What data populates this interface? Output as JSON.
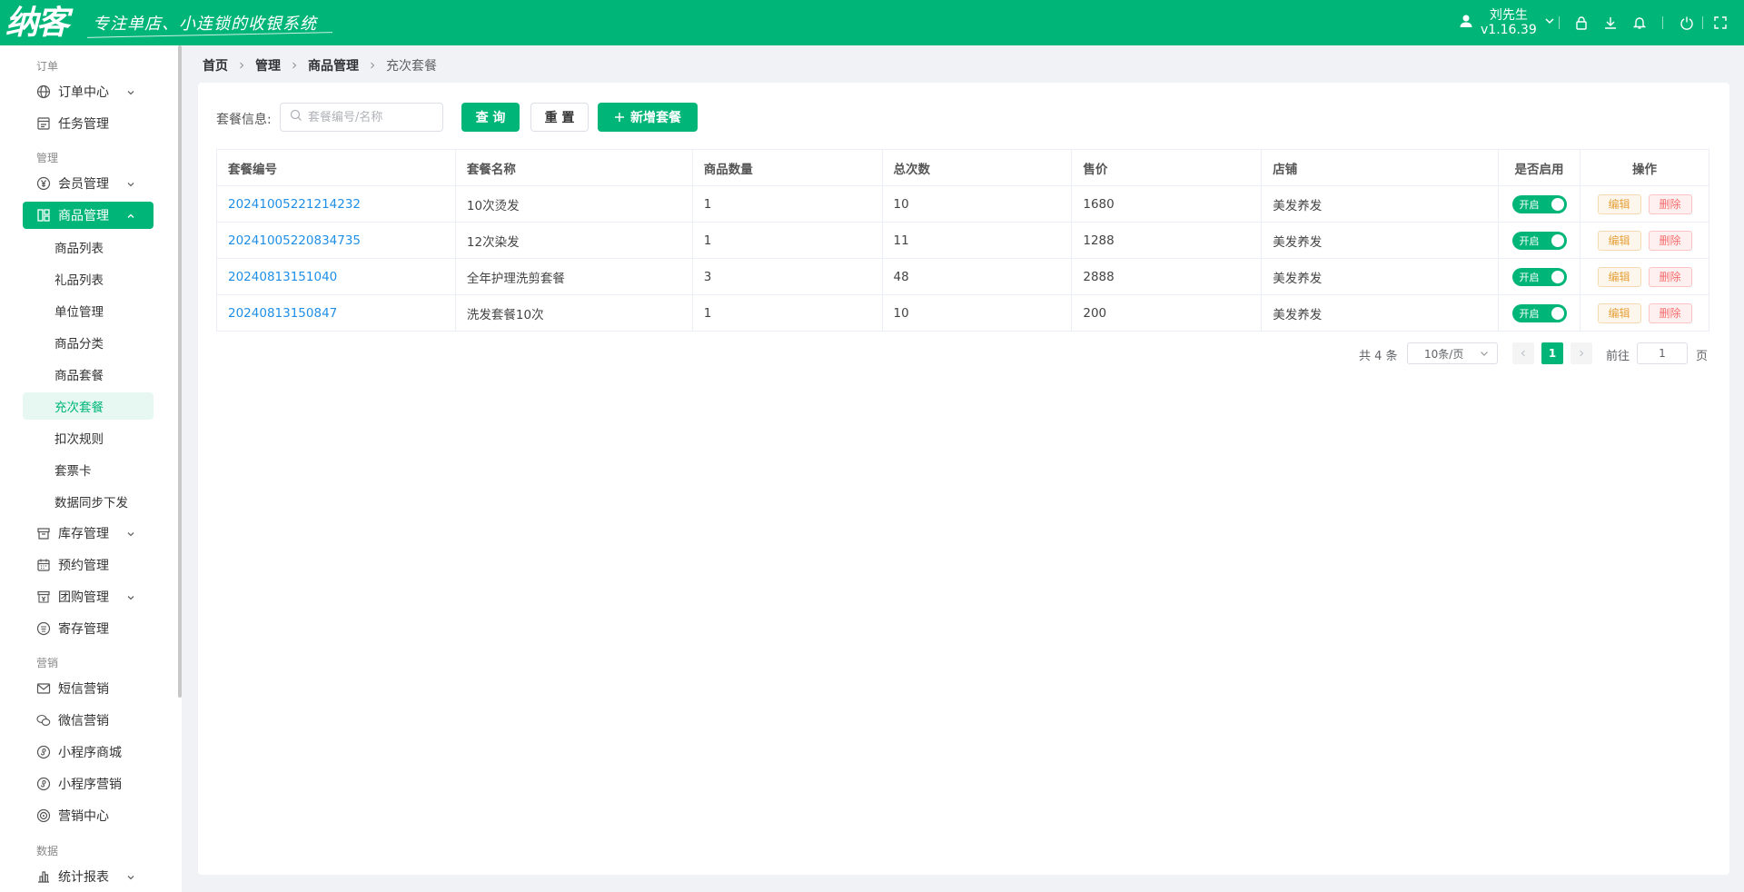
{
  "header": {
    "logo": "纳客",
    "slogan": "专注单店、小连锁的收银系统",
    "user_name": "刘先生",
    "version": "v1.16.39",
    "icons": [
      "user-icon",
      "lock-icon",
      "download-icon",
      "bell-icon",
      "power-icon",
      "fullscreen-icon"
    ]
  },
  "sidebar": {
    "groups": {
      "order": "订单",
      "manage": "管理",
      "marketing": "营销",
      "data": "数据"
    },
    "items": {
      "order_center": "订单中心",
      "task_manage": "任务管理",
      "member_manage": "会员管理",
      "goods_manage": "商品管理",
      "goods_list": "商品列表",
      "gift_list": "礼品列表",
      "unit_manage": "单位管理",
      "goods_category": "商品分类",
      "goods_package": "商品套餐",
      "recharge_package": "充次套餐",
      "deduct_rules": "扣次规则",
      "ticket_card": "套票卡",
      "data_sync": "数据同步下发",
      "stock_manage": "库存管理",
      "booking_manage": "预约管理",
      "group_buy_manage": "团购管理",
      "deposit_manage": "寄存管理",
      "sms_marketing": "短信营销",
      "wechat_marketing": "微信营销",
      "mini_mall": "小程序商城",
      "mini_marketing": "小程序营销",
      "marketing_center": "营销中心",
      "stat_report": "统计报表"
    }
  },
  "breadcrumb": [
    "首页",
    "管理",
    "商品管理",
    "充次套餐"
  ],
  "filter": {
    "label": "套餐信息:",
    "placeholder": "套餐编号/名称",
    "query": "查 询",
    "reset": "重 置",
    "add": "新增套餐"
  },
  "table": {
    "columns": [
      "套餐编号",
      "套餐名称",
      "商品数量",
      "总次数",
      "售价",
      "店铺",
      "是否启用",
      "操作"
    ],
    "rows": [
      {
        "code": "20241005221214232",
        "name": "10次烫发",
        "qty": "1",
        "times": "10",
        "price": "1680",
        "shop": "美发养发",
        "enabled": "开启"
      },
      {
        "code": "20241005220834735",
        "name": "12次染发",
        "qty": "1",
        "times": "11",
        "price": "1288",
        "shop": "美发养发",
        "enabled": "开启"
      },
      {
        "code": "20240813151040",
        "name": "全年护理洗剪套餐",
        "qty": "3",
        "times": "48",
        "price": "2888",
        "shop": "美发养发",
        "enabled": "开启"
      },
      {
        "code": "20240813150847",
        "name": "洗发套餐10次",
        "qty": "1",
        "times": "10",
        "price": "200",
        "shop": "美发养发",
        "enabled": "开启"
      }
    ],
    "edit_label": "编辑",
    "delete_label": "删除"
  },
  "pagination": {
    "total_text": "共 4 条",
    "page_size": "10条/页",
    "current": "1",
    "goto_label": "前往",
    "goto_value": "1",
    "page_label": "页"
  },
  "colors": {
    "brand": "#00b578",
    "link": "#1f8fe6",
    "edit": "#e6a23c",
    "delete": "#f56c6c"
  }
}
